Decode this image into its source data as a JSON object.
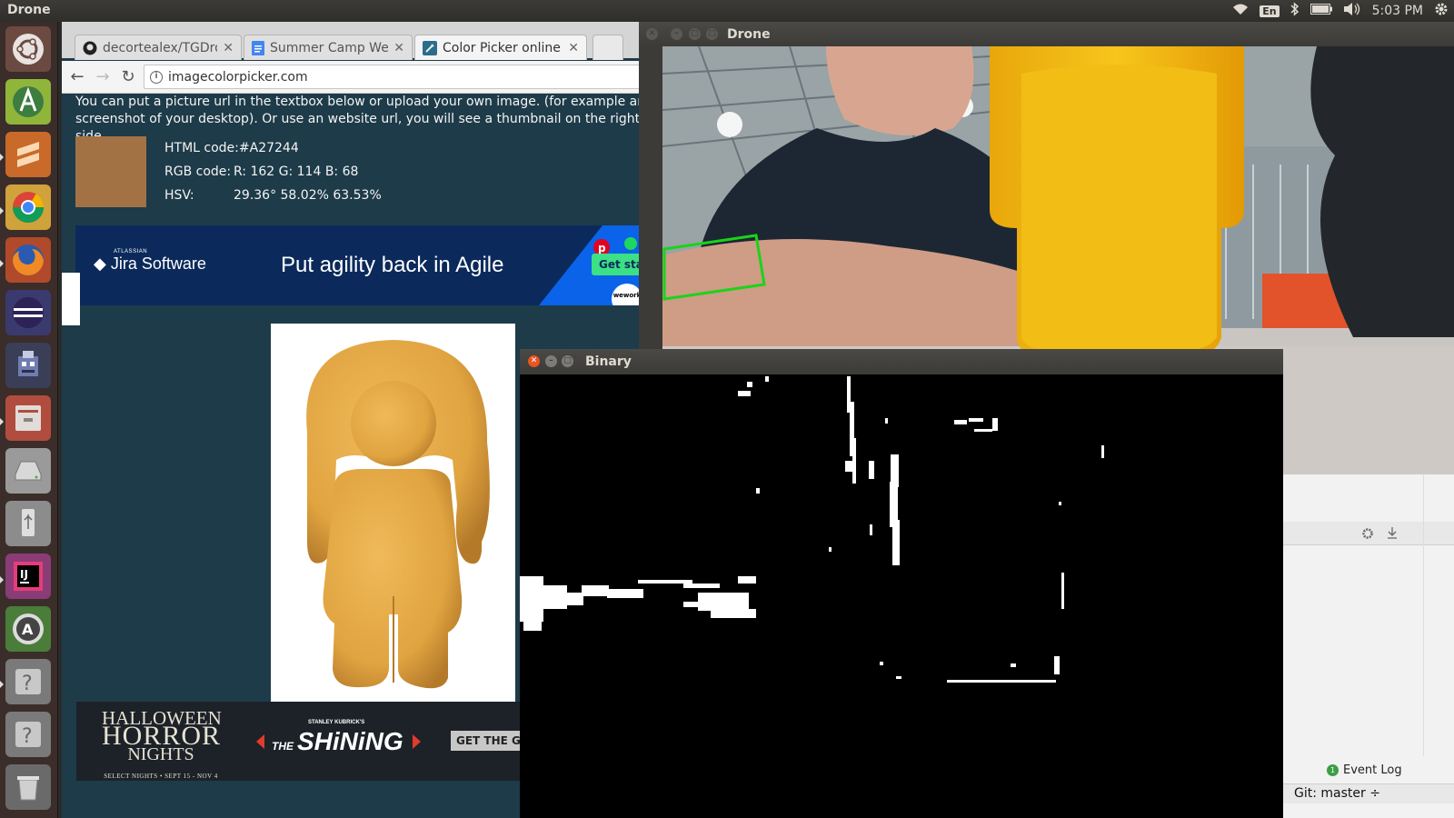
{
  "top_panel": {
    "app_name": "Drone",
    "lang": "En",
    "time": "5:03 PM"
  },
  "launcher": {
    "items": [
      "dash-home",
      "android-studio",
      "sublime-text",
      "chrome",
      "firefox",
      "eclipse",
      "robot-app",
      "files",
      "disk",
      "usb-drive",
      "intellij-idea",
      "software-updater",
      "unknown-app",
      "unknown-app",
      "trash"
    ]
  },
  "browser": {
    "tabs": [
      {
        "title": "decortealex/TGDro",
        "icon": "github-icon"
      },
      {
        "title": "Summer Camp Wee",
        "icon": "docs-icon"
      },
      {
        "title": "Color Picker online",
        "icon": "picker-icon"
      }
    ],
    "url": "imagecolorpicker.com",
    "description": "You can put a picture url in the textbox below or upload your own image. (for example an screenshot of your desktop). Or use an website url, you will see a thumbnail on the right side.",
    "picked_color": "#A27244",
    "color_info": {
      "html_label": "HTML code:",
      "html_value": "#A27244",
      "rgb_label": "RGB code:",
      "rgb_value": "R: 162 G: 114 B: 68",
      "hsv_label": "HSV:",
      "hsv_value": "29.36° 58.02% 63.53%"
    },
    "ad_jira": {
      "brand_small": "ATLASSIAN",
      "brand": "Jira Software",
      "tagline": "Put agility back in Agile",
      "cta": "Get started t",
      "partner": "wework"
    },
    "ad_halloween": {
      "line1": "HALLOWEEN",
      "line2": "HORROR",
      "line3": "NIGHTS",
      "dates": "SELECT NIGHTS • SEPT 15 - NOV 4",
      "presenter": "STANLEY KUBRICK'S",
      "the": "THE",
      "film": "SHiNiNG",
      "cta": "GET THE GOR"
    }
  },
  "drone_window": {
    "title": "Drone"
  },
  "binary_window": {
    "title": "Binary"
  },
  "ide": {
    "event_log": "Event Log",
    "event_count": "1",
    "git": "Git: master ÷"
  },
  "colors": {
    "browser_bg": "#1e3b49",
    "swatch": "#A27244",
    "jira_bg": "#0b2a5b",
    "bounding_box": "#19d419"
  }
}
